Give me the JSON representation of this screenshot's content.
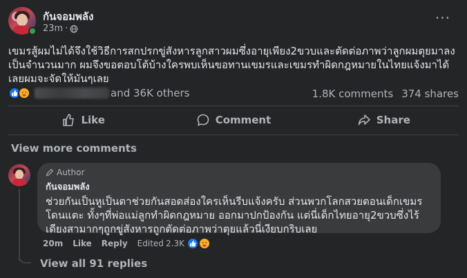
{
  "post": {
    "author": "กันจอมพลัง",
    "time": "23m",
    "text": "เขมรสู้ผมไม่ได้จึงใช้วิธีการสกปรกขู่สังหารลูกสาวผมซึ่งอายุเพียง2ขวบและตัดต่อภาพว่าลูกผมตุยมาลงเป็นจำนวนมาก ผมจึงขอตอบโต้บ้างใครพบเห็นขอทานเขมรและเขมรทำผิดกฎหมายในไทยแจ้งมาได้เลยผมจะจัดให้มันๆเลย",
    "reactions_others": "and 36K others",
    "comments_count": "1.8K comments",
    "shares_count": "374 shares"
  },
  "actions": {
    "like": "Like",
    "comment": "Comment",
    "share": "Share"
  },
  "view_more_comments": "View more comments",
  "comment": {
    "badge": "Author",
    "author": "กันจอมพลัง",
    "text": "ช่วยกันเป็นหูเป็นตาช่วยกันสอดส่องใครเห็นรีบแจ้งครับ ส่วนพวกโลกสวยตอนเด็กเขมรโดนแตะ ทั้งๆที่พ่อแม่ลูกทำผิดกฎหมาย ออกมาปกป้องกัน แต่นี่เด็กไทยอายุ2ขวบซึ่งไร้เดียงสามากๆถูกขู่สังหารถูกตัดต่อภาพว่าตุยแล้วนี่เงียบกริบเลย",
    "time": "20m",
    "like": "Like",
    "reply": "Reply",
    "edited": "Edited",
    "reactions_count": "2.3K",
    "view_replies": "View all 91 replies"
  },
  "icons": {
    "like_reaction": "thumbs-up-icon",
    "care_reaction": "care-emoji-icon",
    "privacy": "globe-icon",
    "more": "more-dots-icon",
    "author_badge": "pencil-icon"
  },
  "colors": {
    "background": "#242526",
    "bubble": "#3a3b3c",
    "text_primary": "#e4e6eb",
    "text_secondary": "#b0b3b8",
    "like_blue": "#1877f2",
    "online_green": "#31a24c"
  }
}
